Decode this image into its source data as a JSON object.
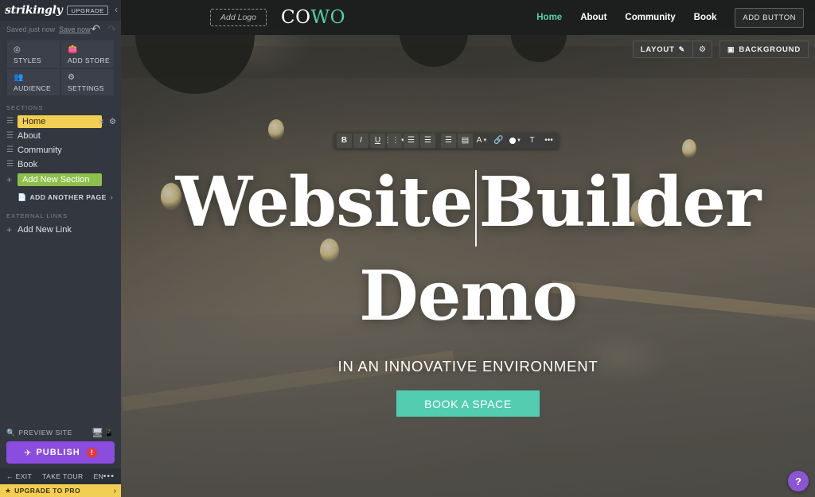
{
  "editor": {
    "brand": "strikingly",
    "upgrade_badge": "UPGRADE",
    "collapse_icon": "chevron-left-icon",
    "save_status": "Saved just now",
    "save_now_label": "Save now",
    "undo_icon": "undo-icon",
    "redo_icon": "redo-icon",
    "quick_actions": [
      {
        "label": "STYLES",
        "icon": "paint-icon"
      },
      {
        "label": "ADD STORE",
        "icon": "shopping-bag-icon"
      },
      {
        "label": "AUDIENCE",
        "icon": "audience-icon"
      },
      {
        "label": "SETTINGS",
        "icon": "gear-icon"
      }
    ],
    "sections_header": "SECTIONS",
    "sections": [
      {
        "label": "Home",
        "active": true
      },
      {
        "label": "About",
        "active": false
      },
      {
        "label": "Community",
        "active": false
      },
      {
        "label": "Book",
        "active": false
      }
    ],
    "add_new_section_label": "Add New Section",
    "add_another_page_label": "ADD ANOTHER PAGE",
    "external_links_header": "EXTERNAL LINKS",
    "add_new_link_label": "Add New Link",
    "preview_site_label": "PREVIEW SITE",
    "publish_label": "PUBLISH",
    "publish_badge": "!",
    "footer": {
      "exit": "EXIT",
      "take_tour": "TAKE TOUR",
      "language": "EN",
      "more": "•••"
    },
    "upgrade_to_pro": "UPGRADE TO PRO",
    "colors": {
      "active_section": "#f2cf53",
      "add_section": "#8cc04a",
      "publish": "#8b4ce0",
      "upgrade_bar": "#f2cf53",
      "help": "#8b55d6"
    }
  },
  "canvas": {
    "site_nav": {
      "add_logo_label": "Add Logo",
      "logo_part1": "CO",
      "logo_part2": "WO",
      "links": [
        {
          "label": "Home",
          "active": true
        },
        {
          "label": "About",
          "active": false
        },
        {
          "label": "Community",
          "active": false
        },
        {
          "label": "Book",
          "active": false
        }
      ],
      "add_button_label": "ADD BUTTON"
    },
    "edit_controls": {
      "layout_label": "LAYOUT",
      "layout_icon": "pencil-icon",
      "layout_gear_icon": "gear-icon",
      "background_label": "BACKGROUND",
      "background_icon": "image-icon"
    },
    "rte_toolbar": [
      {
        "name": "bold",
        "glyph": "B"
      },
      {
        "name": "italic",
        "glyph": "I"
      },
      {
        "name": "underline",
        "glyph": "U"
      },
      {
        "name": "list",
        "glyph": "☷"
      },
      {
        "name": "align-left",
        "glyph": "☰"
      },
      {
        "name": "align-center",
        "glyph": "☰"
      },
      {
        "name": "indent",
        "glyph": "☰"
      },
      {
        "name": "line-height",
        "glyph": "▤"
      },
      {
        "name": "font-size",
        "glyph": "A"
      },
      {
        "name": "link",
        "glyph": "🔗"
      },
      {
        "name": "text-color",
        "glyph": "●"
      },
      {
        "name": "clear-format",
        "glyph": "T"
      },
      {
        "name": "more",
        "glyph": "•••"
      }
    ],
    "handles": [
      {
        "name": "move",
        "glyph": "✥"
      },
      {
        "name": "delete",
        "glyph": "🗑"
      }
    ],
    "hero": {
      "title_line1": "Website",
      "title_line2": "Builder",
      "title_line3": "Demo",
      "subtitle": "IN AN INNOVATIVE ENVIRONMENT",
      "cta_label": "BOOK A SPACE",
      "cta_color": "#52cdb0"
    },
    "help_glyph": "?"
  }
}
